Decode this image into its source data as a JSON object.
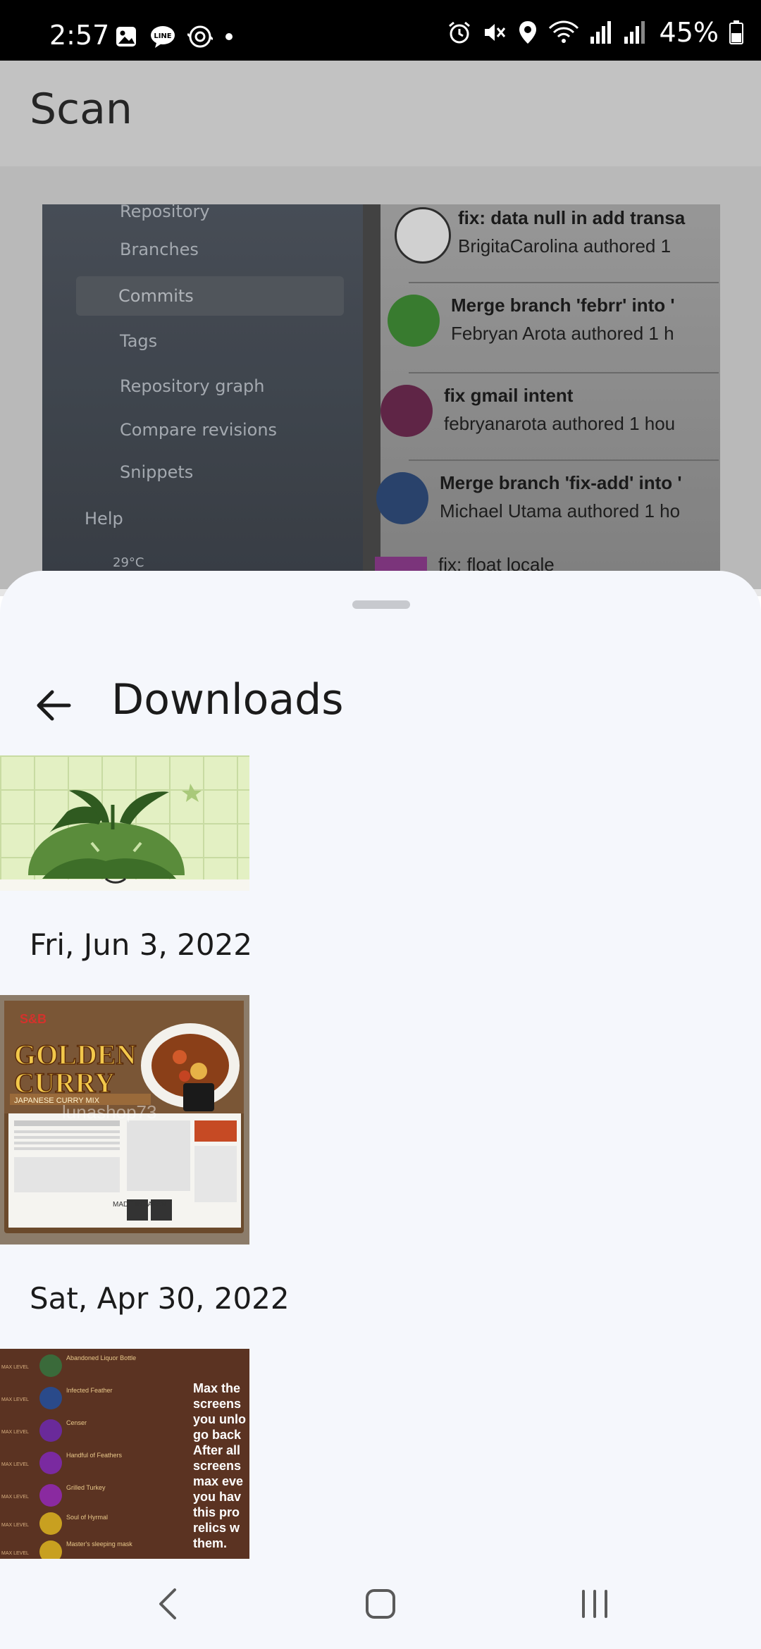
{
  "status_bar": {
    "time": "2:57",
    "battery": "45%"
  },
  "scan_page": {
    "title": "Scan",
    "preview": {
      "menu_items": [
        "Repository",
        "Branches",
        "Commits",
        "Tags",
        "Repository graph",
        "Compare revisions",
        "Snippets"
      ],
      "help_label": "Help",
      "weather": "29°C",
      "commits": [
        {
          "title": "fix: data null in add transa",
          "author": "BrigitaCarolina authored 1"
        },
        {
          "title": "Merge branch 'febrr' into '",
          "author": "Febryan Arota authored 1 h"
        },
        {
          "title": "fix gmail intent",
          "author": "febryanarota authored 1 hou"
        },
        {
          "title": "Merge branch 'fix-add' into '",
          "author": "Michael Utama authored 1 ho"
        },
        {
          "title": "fix: float locale",
          "author": ""
        }
      ]
    }
  },
  "sheet": {
    "title": "Downloads",
    "items": [
      {
        "date": ""
      },
      {
        "date": "Fri, Jun 3, 2022"
      },
      {
        "date": "Sat, Apr 30, 2022"
      }
    ],
    "curry_text": {
      "brand": "S&B",
      "name1": "GOLDEN",
      "name2": "CURRY",
      "sub": "JAPANESE CURRY MIX",
      "watermark": "lunashop73",
      "made": "MADE IN JAPAN"
    },
    "game_text": {
      "lines": [
        "Max the",
        "screens",
        "you unlo",
        "go back",
        "After all",
        "screens",
        "max eve",
        "you hav",
        "this pro",
        "relics w",
        "them."
      ],
      "relics": [
        "Abandoned Liquor Bottle",
        "Infected Feather",
        "Censer",
        "Handful of Feathers",
        "Grilled Turkey",
        "Soul of Hyrmal",
        "Master's sleeping mask"
      ],
      "max_level": "MAX LEVEL"
    }
  },
  "colors": {
    "sheet_bg": "#f5f7fc",
    "status_bg": "#000000"
  }
}
